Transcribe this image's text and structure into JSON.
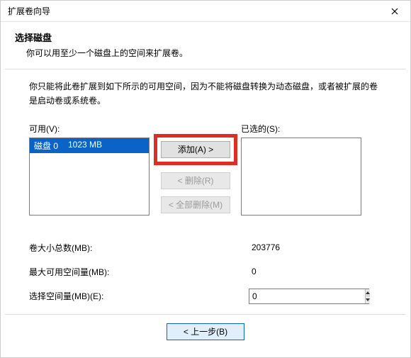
{
  "window": {
    "title": "扩展卷向导"
  },
  "header": {
    "title": "选择磁盘",
    "subtitle": "你可以用至少一个磁盘上的空间来扩展卷。"
  },
  "description": "你只能将此卷扩展到如下所示的可用空间，因为不能将磁盘转换为动态磁盘，或者被扩展的卷是启动卷或系统卷。",
  "available": {
    "label": "可用(V):",
    "items": [
      {
        "disk": "磁盘 0",
        "size": "1023 MB",
        "selected": true
      }
    ]
  },
  "selected": {
    "label": "已选的(S):",
    "items": []
  },
  "buttons": {
    "add": "添加(A) >",
    "remove": "< 删除(R)",
    "remove_all": "< 全部删除(M)",
    "back": "< 上一步(B)"
  },
  "fields": {
    "total_label": "卷大小总数(MB):",
    "total_value": "203776",
    "max_label": "最大可用空间量(MB):",
    "max_value": "0",
    "select_label": "选择空间量(MB)(E):",
    "select_value": "0"
  }
}
